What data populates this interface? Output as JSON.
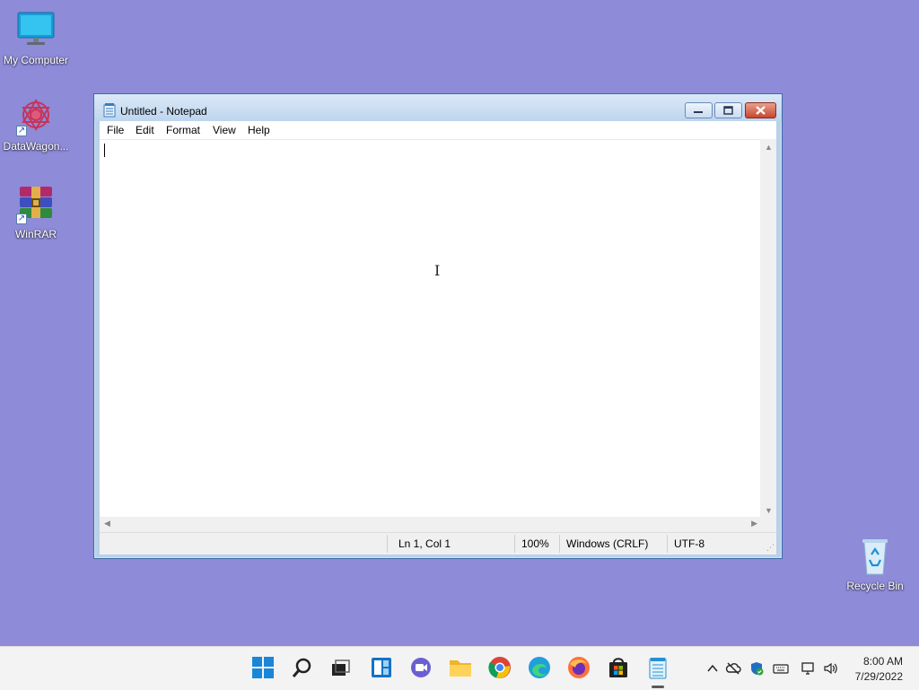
{
  "desktop": {
    "icons": [
      {
        "label": "My Computer",
        "icon": "monitor-icon"
      },
      {
        "label": "DataWagon...",
        "icon": "datawagon-icon"
      },
      {
        "label": "WinRAR",
        "icon": "winrar-icon"
      },
      {
        "label": "Recycle Bin",
        "icon": "recycle-bin-icon"
      }
    ],
    "background_color": "#8e8bd9"
  },
  "window": {
    "title": "Untitled - Notepad",
    "menu": [
      "File",
      "Edit",
      "Format",
      "View",
      "Help"
    ],
    "editor_text": "",
    "status": {
      "position": "Ln 1, Col 1",
      "zoom": "100%",
      "line_ending": "Windows (CRLF)",
      "encoding": "UTF-8"
    }
  },
  "taskbar": {
    "apps": [
      "start-icon",
      "search-icon",
      "task-view-icon",
      "widgets-icon",
      "chat-icon",
      "file-explorer-icon",
      "chrome-icon",
      "edge-icon",
      "firefox-icon",
      "store-icon",
      "notepad-icon"
    ],
    "clock": {
      "time": "8:00 AM",
      "date": "7/29/2022"
    }
  }
}
